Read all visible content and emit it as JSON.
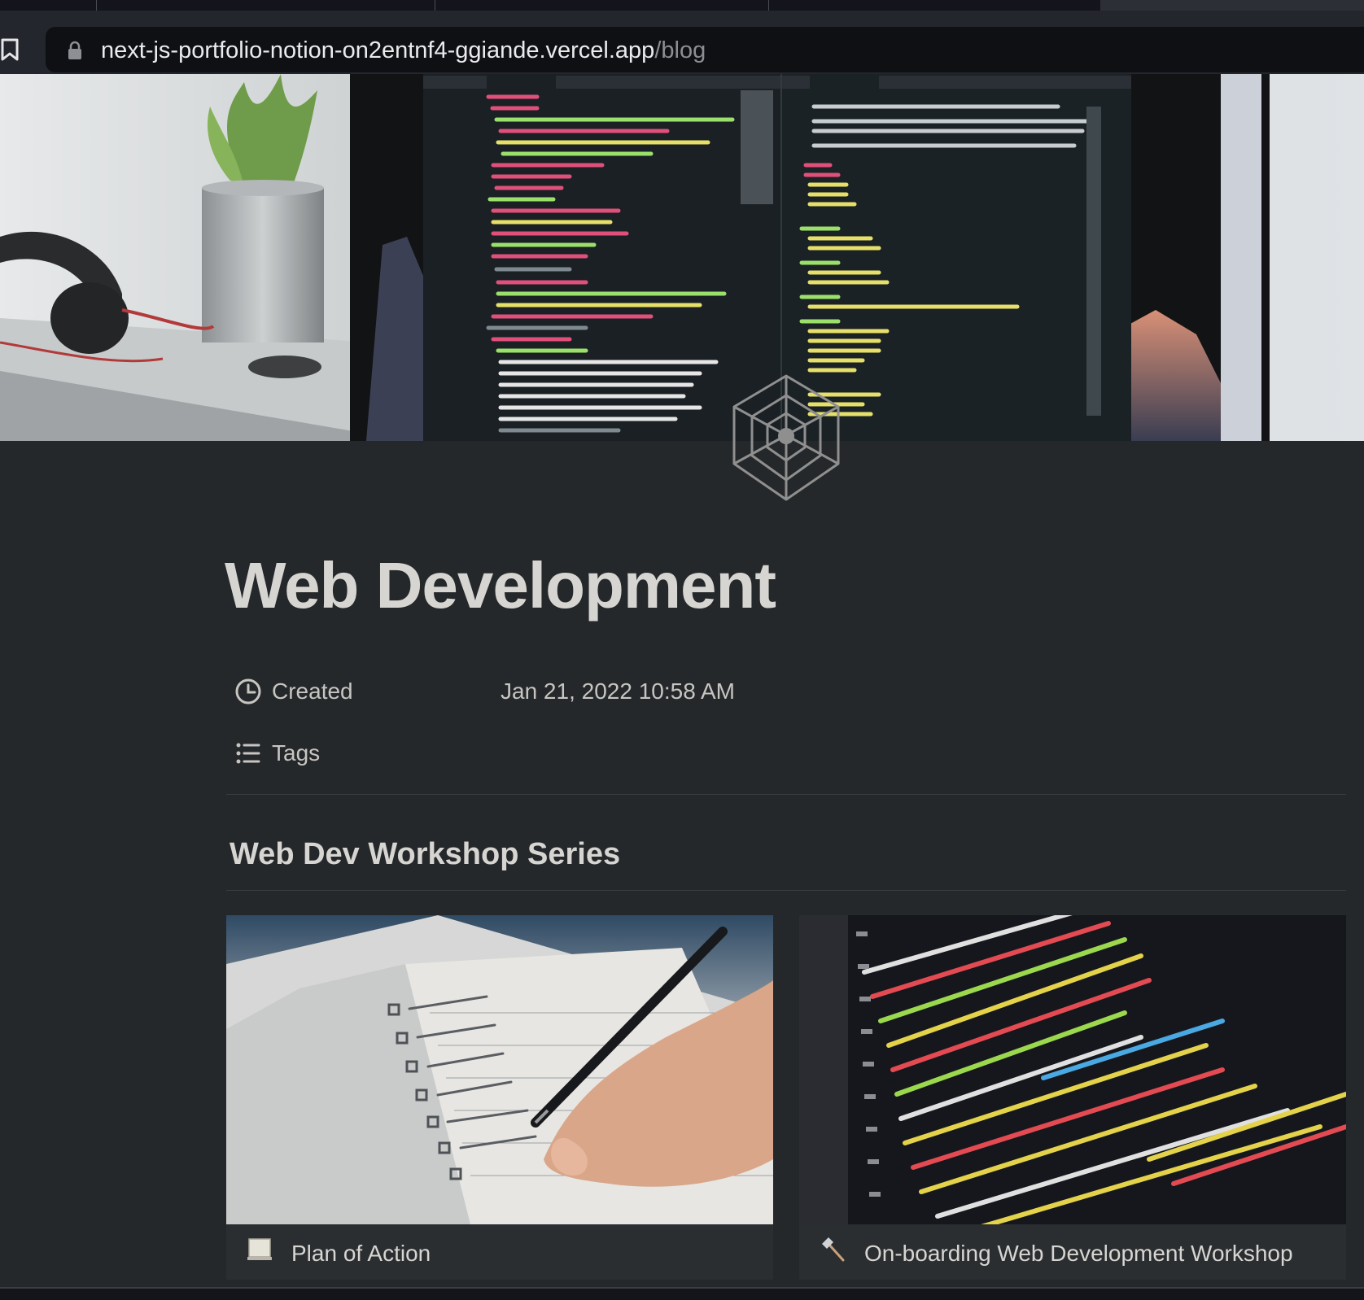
{
  "browser": {
    "url_host": "next-js-portfolio-notion-on2entnf4-ggiande.vercel.app",
    "url_path": "/blog"
  },
  "page": {
    "title": "Web Development",
    "icon": "spider-web-icon",
    "cover": "laptop-code-editor-photo",
    "properties": [
      {
        "icon": "clock-icon",
        "label": "Created",
        "value": "Jan 21, 2022 10:58 AM"
      },
      {
        "icon": "list-icon",
        "label": "Tags",
        "value": ""
      }
    ]
  },
  "section": {
    "heading": "Web Dev Workshop Series",
    "cards": [
      {
        "title": "Plan of Action",
        "emoji": "notebook-icon",
        "cover": "hand-writing-checklist-photo"
      },
      {
        "title": "On-boarding Web Development Workshop",
        "emoji": "hammer-icon",
        "cover": "php-code-screen-photo"
      }
    ]
  },
  "colors": {
    "page_background": "#25282a",
    "title_text": "#d6d5d2",
    "property_text": "#c6c5c2",
    "url_path_text": "#8d8e93"
  }
}
